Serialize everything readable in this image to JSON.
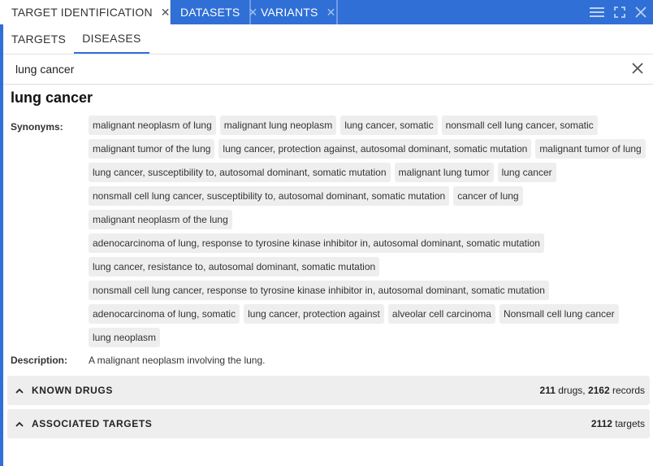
{
  "tabs": [
    {
      "label": "TARGET IDENTIFICATION",
      "active": true
    },
    {
      "label": "DATASETS",
      "active": false
    },
    {
      "label": "VARIANTS",
      "active": false
    }
  ],
  "subtabs": [
    {
      "label": "TARGETS",
      "active": false
    },
    {
      "label": "DISEASES",
      "active": true
    }
  ],
  "search": {
    "value": "lung cancer"
  },
  "disease": {
    "title": "lung cancer",
    "synonyms_label": "Synonyms:",
    "synonyms": [
      "malignant neoplasm of lung",
      "malignant lung neoplasm",
      "lung cancer, somatic",
      "nonsmall cell lung cancer, somatic",
      "malignant tumor of the lung",
      "lung cancer, protection against, autosomal dominant, somatic mutation",
      "malignant tumor of lung",
      "lung cancer, susceptibility to, autosomal dominant, somatic mutation",
      "malignant lung tumor",
      "lung cancer",
      "nonsmall cell lung cancer, susceptibility to, autosomal dominant, somatic mutation",
      "cancer of lung",
      "malignant neoplasm of the lung",
      "adenocarcinoma of lung, response to tyrosine kinase inhibitor in, autosomal dominant, somatic mutation",
      "lung cancer, resistance to, autosomal dominant, somatic mutation",
      "nonsmall cell lung cancer, response to tyrosine kinase inhibitor in, autosomal dominant, somatic mutation",
      "adenocarcinoma of lung, somatic",
      "lung cancer, protection against",
      "alveolar cell carcinoma",
      "Nonsmall cell lung cancer",
      "lung neoplasm"
    ],
    "description_label": "Description:",
    "description": "A malignant neoplasm involving the lung."
  },
  "sections": {
    "known_drugs": {
      "title": "KNOWN DRUGS",
      "drugs_count": "211",
      "drugs_unit": " drugs,",
      "records_count": "2162",
      "records_unit": " records"
    },
    "associated_targets": {
      "title": "ASSOCIATED TARGETS",
      "targets_count": "2112",
      "targets_unit": " targets"
    }
  },
  "icons": {
    "tab_close": "close-icon",
    "menu": "hamburger-menu-icon",
    "fullscreen": "fullscreen-icon",
    "window_close": "close-icon",
    "search_clear": "close-icon",
    "section_toggle": "chevron-up-icon"
  },
  "colors": {
    "accent": "#2f6fd6",
    "chip_bg": "#eeeeee",
    "section_bg": "#eeeeee"
  }
}
